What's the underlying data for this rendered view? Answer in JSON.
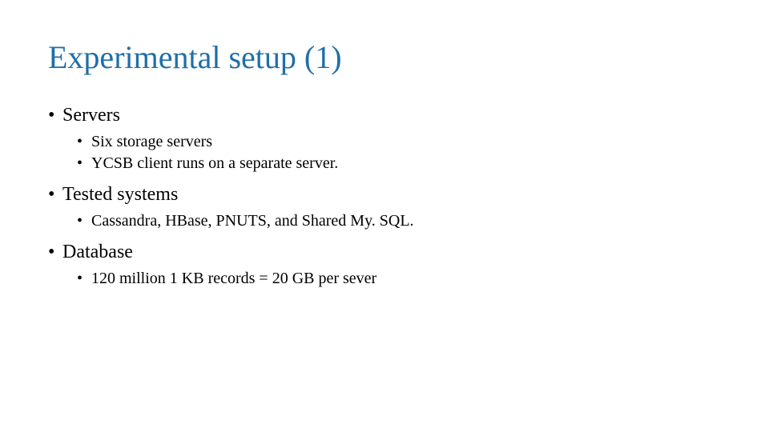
{
  "title": "Experimental setup (1)",
  "sections": [
    {
      "heading": "Servers",
      "items": [
        "Six storage servers",
        "YCSB client runs on a separate server."
      ]
    },
    {
      "heading": "Tested systems",
      "items": [
        "Cassandra, HBase, PNUTS, and Shared My. SQL."
      ]
    },
    {
      "heading": "Database",
      "items": [
        "120 million 1 KB records = 20 GB per sever"
      ]
    }
  ]
}
